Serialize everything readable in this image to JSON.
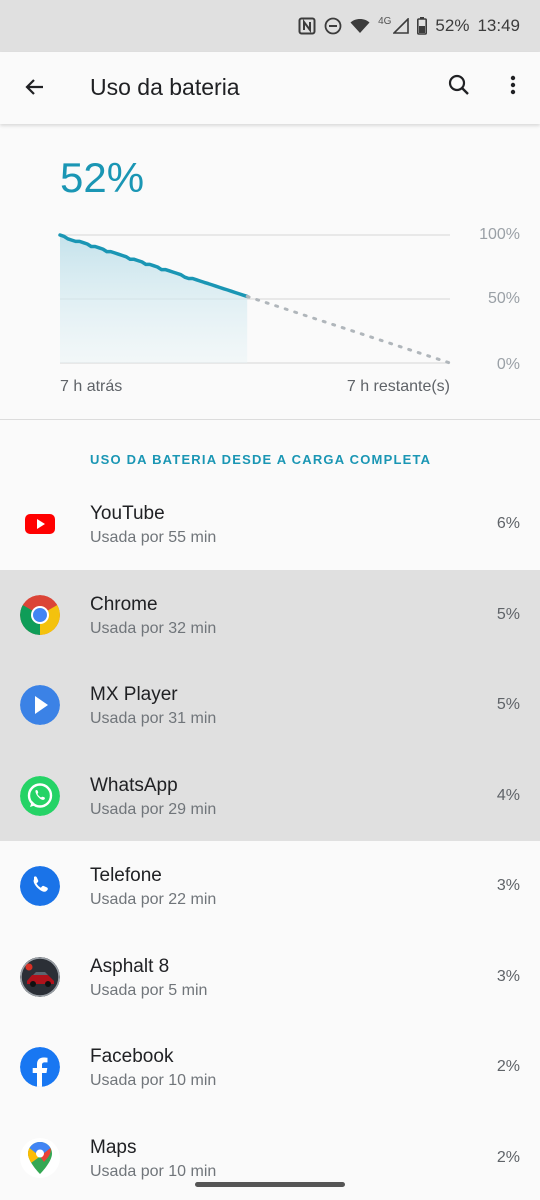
{
  "status_bar": {
    "network_type": "4G",
    "battery_percent": "52%",
    "time": "13:49",
    "icons": [
      "nfc-icon",
      "do-not-disturb-icon",
      "wifi-icon",
      "cell-signal-icon",
      "battery-icon"
    ]
  },
  "app_bar": {
    "title": "Uso da bateria",
    "back_icon": "arrow-back-icon",
    "search_icon": "search-icon",
    "more_icon": "more-vert-icon"
  },
  "summary": {
    "battery_level": "52%",
    "time_ago_label": "7 h atrás",
    "time_remaining_label": "7 h restante(s)",
    "ticks": [
      "100%",
      "50%",
      "0%"
    ],
    "accent_color": "#1a96b4"
  },
  "chart_data": {
    "type": "area",
    "x_start_label": "7 h atrás",
    "x_end_label": "7 h restante(s)",
    "ylim": [
      0,
      100
    ],
    "y_ticks": [
      "100%",
      "50%",
      "0%"
    ],
    "series": [
      {
        "values_percent": [
          100,
          99,
          97,
          96,
          95,
          95,
          94,
          93,
          91,
          91,
          90,
          89,
          87,
          87,
          86,
          85,
          84,
          83,
          81,
          81,
          80,
          79,
          77,
          77,
          76,
          75,
          73,
          73,
          72,
          71,
          70,
          69,
          67,
          66,
          66,
          65,
          64,
          63,
          62,
          61,
          60,
          59,
          58,
          57,
          56,
          55,
          54,
          53,
          52
        ]
      }
    ],
    "projection": {
      "from_percent": 52,
      "to_percent": 0
    },
    "elapsed_fraction_of_width": 0.48
  },
  "section": {
    "header": "USO DA BATERIA DESDE A CARGA COMPLETA"
  },
  "apps": [
    {
      "name": "YouTube",
      "usage": "Usada por 55 min",
      "percent": "6%",
      "icon": "youtube-icon",
      "selected": false
    },
    {
      "name": "Chrome",
      "usage": "Usada por 32 min",
      "percent": "5%",
      "icon": "chrome-icon",
      "selected": true
    },
    {
      "name": "MX Player",
      "usage": "Usada por 31 min",
      "percent": "5%",
      "icon": "mx-player-icon",
      "selected": true
    },
    {
      "name": "WhatsApp",
      "usage": "Usada por 29 min",
      "percent": "4%",
      "icon": "whatsapp-icon",
      "selected": true
    },
    {
      "name": "Telefone",
      "usage": "Usada por 22 min",
      "percent": "3%",
      "icon": "phone-icon",
      "selected": false
    },
    {
      "name": "Asphalt 8",
      "usage": "Usada por 5 min",
      "percent": "3%",
      "icon": "asphalt-8-icon",
      "selected": false
    },
    {
      "name": "Facebook",
      "usage": "Usada por 10 min",
      "percent": "2%",
      "icon": "facebook-icon",
      "selected": false
    },
    {
      "name": "Maps",
      "usage": "Usada por 10 min",
      "percent": "2%",
      "icon": "maps-icon",
      "selected": false
    }
  ]
}
